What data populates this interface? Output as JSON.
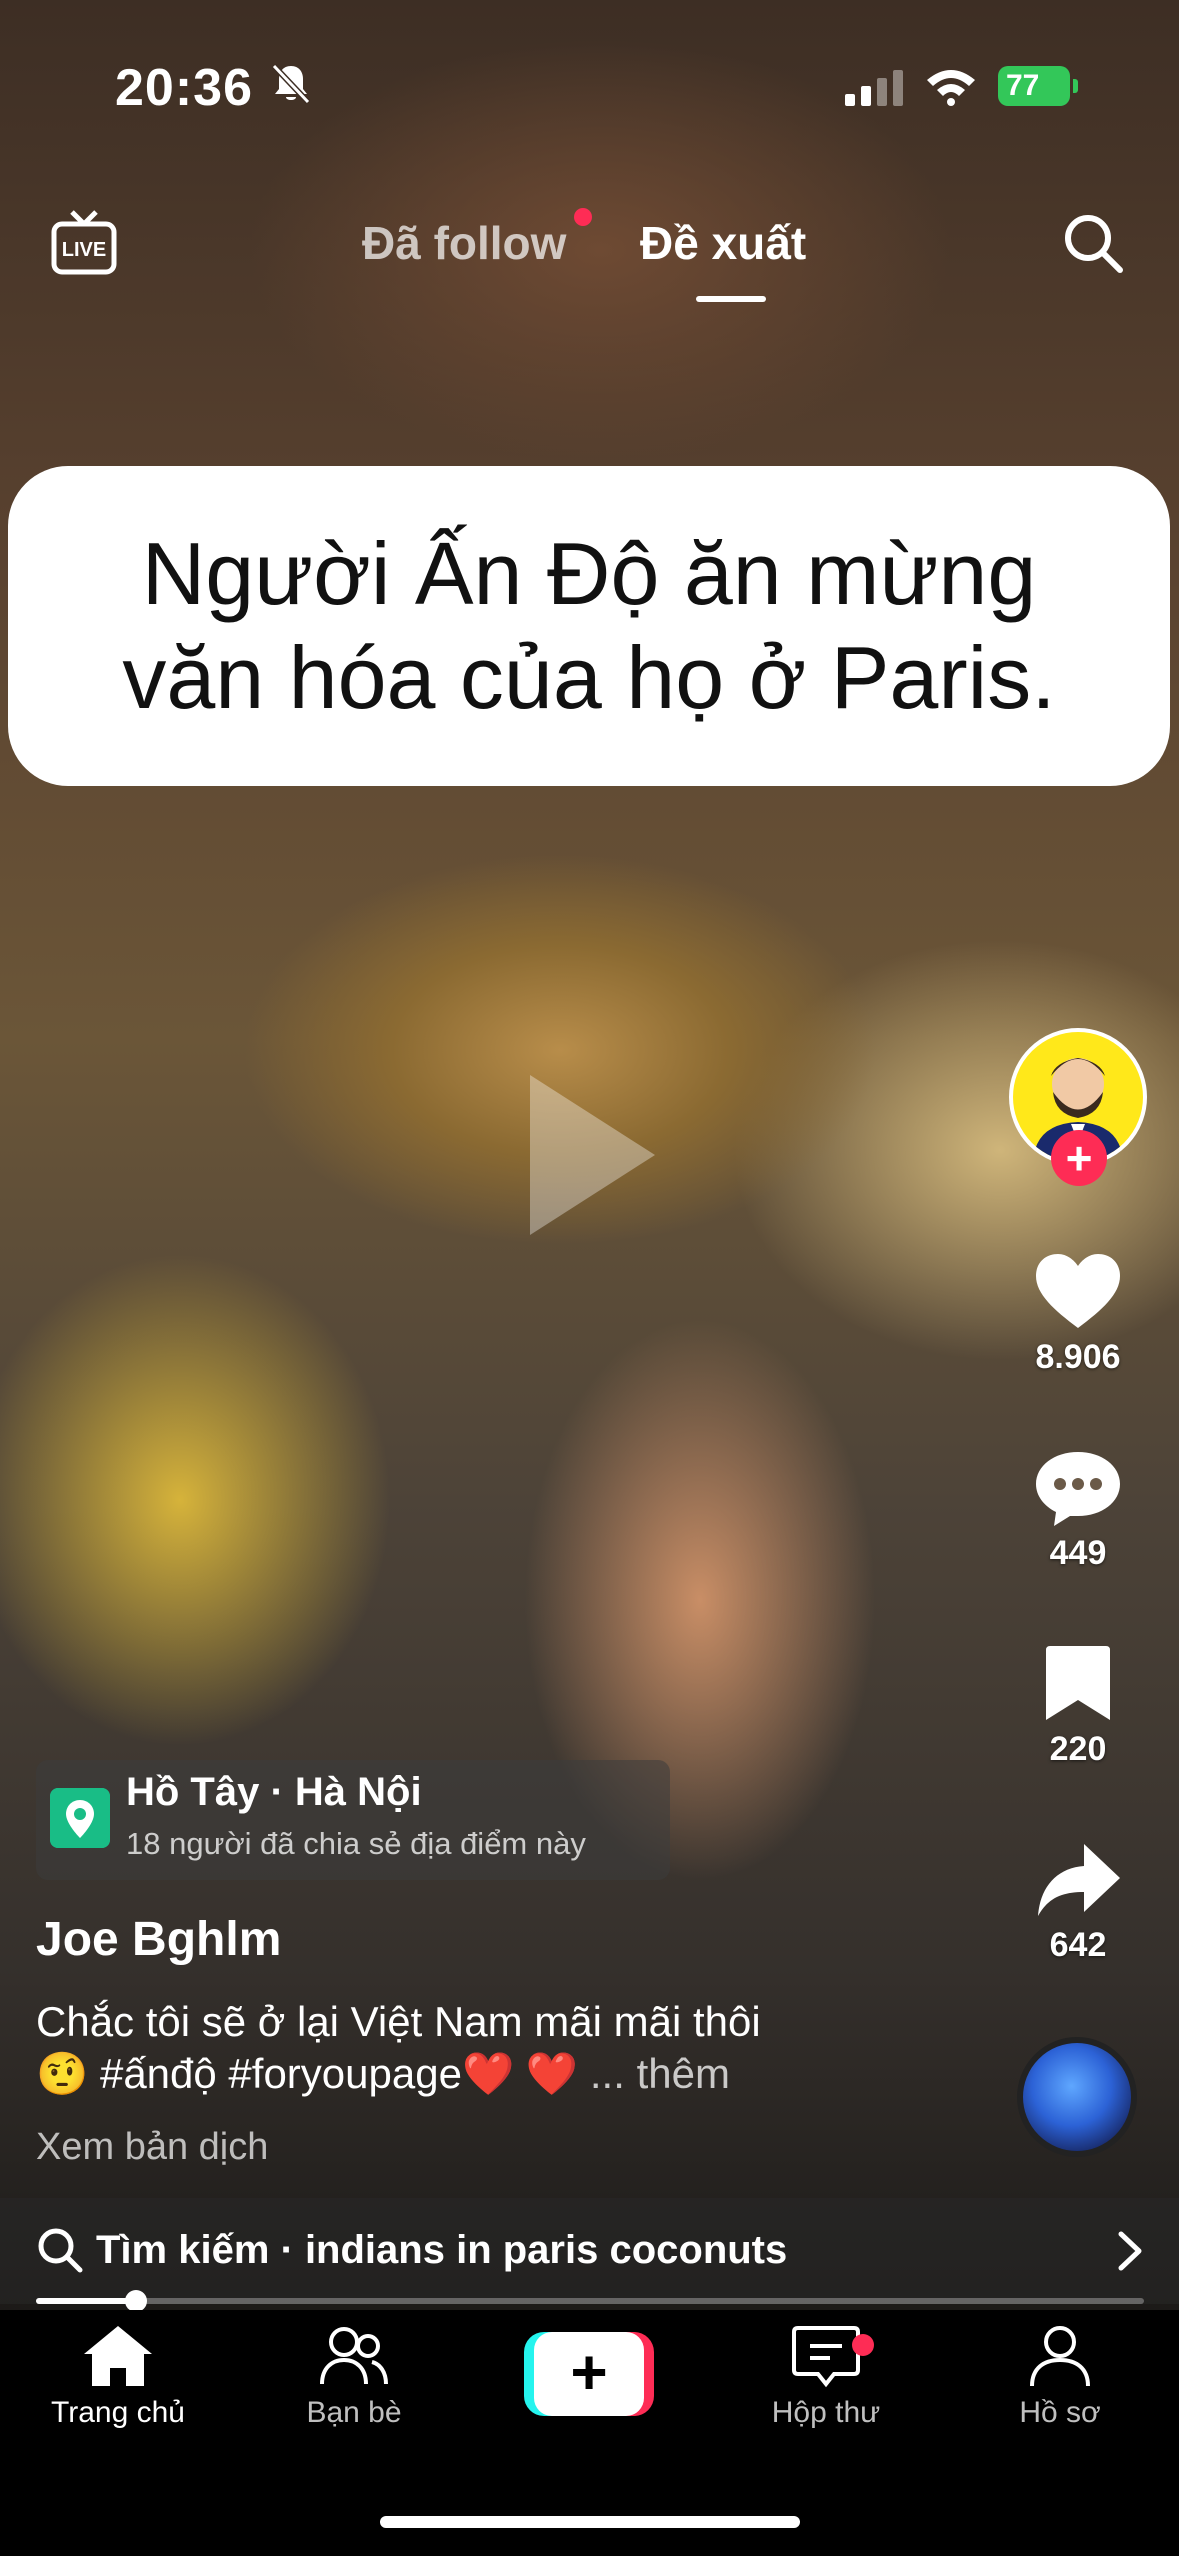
{
  "status_bar": {
    "time": "20:36",
    "battery": "77"
  },
  "top_nav": {
    "live_label": "LIVE",
    "tabs": [
      {
        "label": "Đã follow",
        "active": false
      },
      {
        "label": "Đề xuất",
        "active": true
      }
    ]
  },
  "video": {
    "caption_line1": "Người Ấn Độ ăn mừng",
    "caption_line2": "văn hóa của họ ở Paris."
  },
  "actions": {
    "likes": "8.906",
    "comments": "449",
    "saves": "220",
    "shares": "642"
  },
  "location": {
    "name": "Hồ Tây · Hà Nội",
    "shared": "18 người đã chia sẻ địa điểm này"
  },
  "post": {
    "username": "Joe Bghlm",
    "description_line1": "Chắc tôi sẽ ở lại Việt Nam mãi mãi thôi",
    "description_line2": "🤨 #ấnđộ #foryoupage❤️ ❤️",
    "more": "... thêm",
    "translate": "Xem bản dịch"
  },
  "search_bar": {
    "text": "Tìm kiếm · indians in paris coconuts"
  },
  "progress": {
    "fraction": 0.09
  },
  "bottom_nav": {
    "home": "Trang chủ",
    "friends": "Bạn bè",
    "inbox": "Hộp thư",
    "profile": "Hồ sơ"
  },
  "colors": {
    "accent": "#fe2c55",
    "cyan": "#25f4ee",
    "location_pin": "#19bd86",
    "battery": "#33c759"
  }
}
